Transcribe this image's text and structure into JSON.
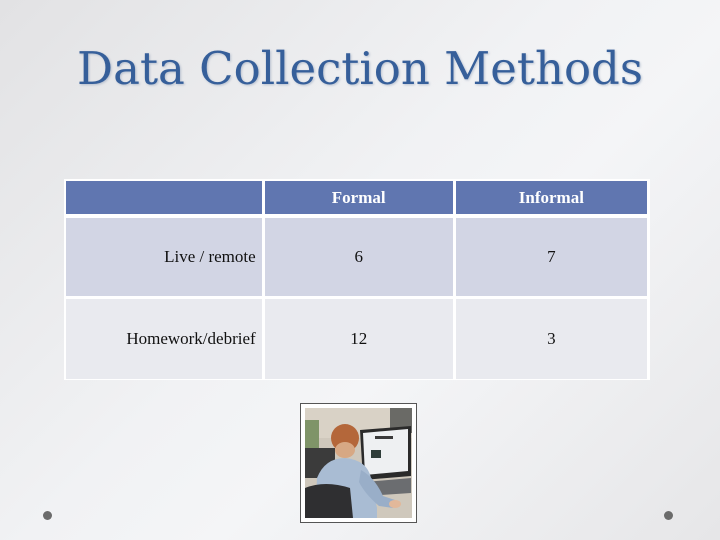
{
  "slide": {
    "title": "Data Collection Methods",
    "table": {
      "headers": [
        "",
        "Formal",
        "Informal"
      ],
      "rows": [
        {
          "label": "Live / remote",
          "formal": "6",
          "informal": "7"
        },
        {
          "label": "Homework/debrief",
          "formal": "12",
          "informal": "3"
        }
      ]
    },
    "image": {
      "description": "person working at a computer monitor"
    },
    "colors": {
      "title": "#365f9a",
      "header_bg": "#6076b0",
      "row_odd_bg": "#d2d5e4",
      "row_even_bg": "#e9eaef"
    }
  }
}
